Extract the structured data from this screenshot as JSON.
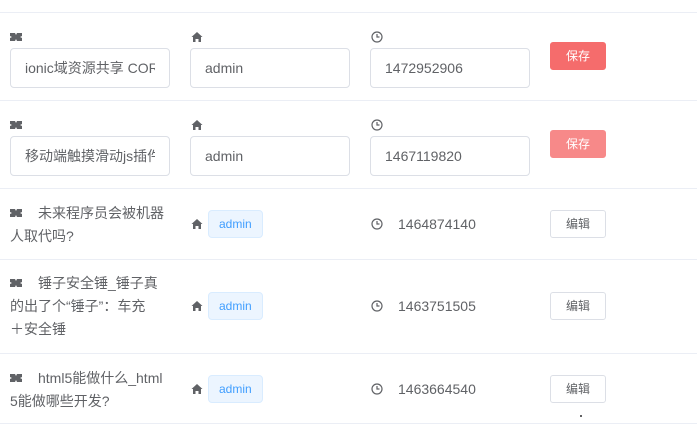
{
  "icons": {
    "title": "ticket-icon",
    "author": "home-icon",
    "time": "clock-icon"
  },
  "colors": {
    "danger": "#f56c6c",
    "danger_light": "#f78989",
    "tag_text": "#409eff",
    "tag_bg": "#ecf5ff",
    "border": "#dcdfe6",
    "divider": "#ebeef5"
  },
  "rows": [
    {
      "mode": "edit",
      "title_value": "ionic域资源共享 COR",
      "author_value": "admin",
      "time_value": "1472952906",
      "action_label": "保存"
    },
    {
      "mode": "edit",
      "title_value": "移动端触摸滑动js插件",
      "author_value": "admin",
      "time_value": "1467119820",
      "action_label": "保存"
    },
    {
      "mode": "view",
      "title_line1": "未来程序员会被机器",
      "title_line2": "人取代吗?",
      "author": "admin",
      "time": "1464874140",
      "action_label": "编辑"
    },
    {
      "mode": "view",
      "title_line1": "锤子安全锤_锤子真",
      "title_line2": "的出了个“锤子”：车充",
      "title_line3": "＋安全锤",
      "author": "admin",
      "time": "1463751505",
      "action_label": "编辑"
    },
    {
      "mode": "view",
      "title_line1": "html5能做什么_html",
      "title_line2": "5能做哪些开发?",
      "author": "admin",
      "time": "1463664540",
      "action_label": "编辑"
    }
  ]
}
